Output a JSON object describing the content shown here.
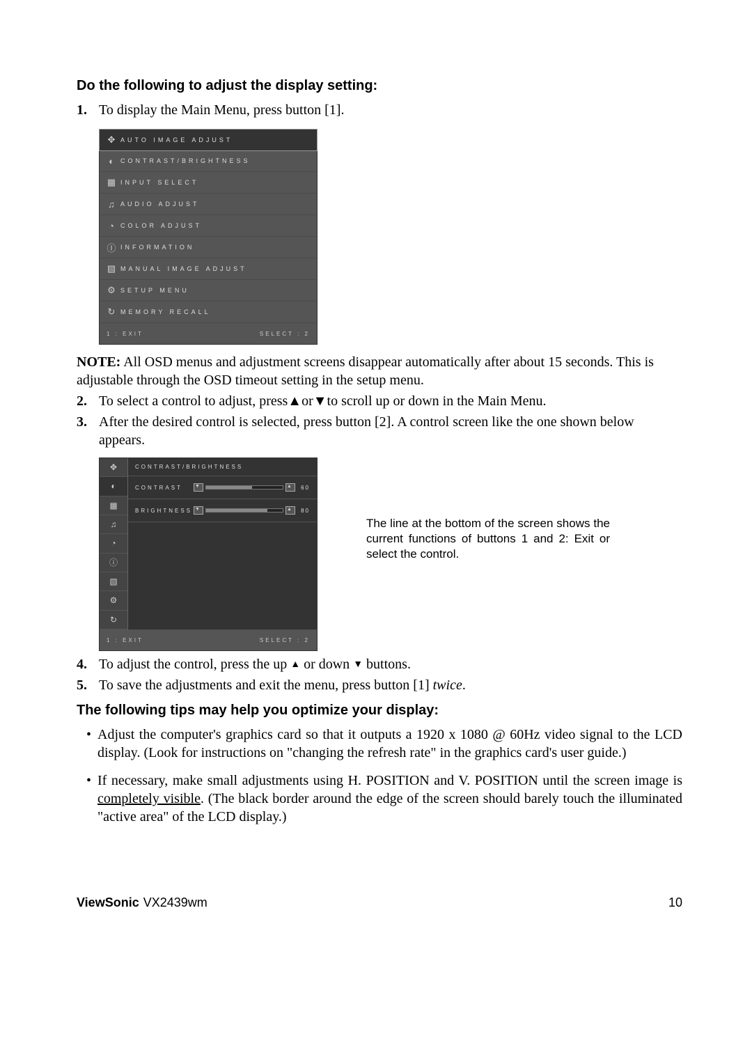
{
  "heading1": "Do the following to adjust the display setting:",
  "steps_a": [
    "To display the Main Menu, press button [1]."
  ],
  "osd1_items": [
    "AUTO IMAGE ADJUST",
    "CONTRAST/BRIGHTNESS",
    "INPUT SELECT",
    "AUDIO ADJUST",
    "COLOR ADJUST",
    "INFORMATION",
    "MANUAL IMAGE ADJUST",
    "SETUP MENU",
    "MEMORY RECALL"
  ],
  "osd_footer_left": "1 : EXIT",
  "osd_footer_right": "SELECT : 2",
  "note_prefix": "NOTE:",
  "note_text": " All OSD menus and adjustment screens disappear automatically after about 15 seconds. This is adjustable through the OSD timeout setting in the setup menu.",
  "steps_b": [
    {
      "n": "2.",
      "t": "To select a control to adjust, press▲or▼to scroll up or down in the Main Menu."
    },
    {
      "n": "3.",
      "t": "After the desired control is selected, press button [2]. A control screen like the one shown below appears."
    }
  ],
  "osd2": {
    "title": "CONTRAST/BRIGHTNESS",
    "rows": [
      {
        "label": "CONTRAST",
        "value": "60"
      },
      {
        "label": "BRIGHTNESS",
        "value": "80"
      }
    ]
  },
  "callout": "The line at the bottom of the screen shows the current functions of buttons 1 and 2: Exit or select the control.",
  "steps_c": [
    {
      "n": "4.",
      "t_a": "To adjust the control, press the up ",
      "t_b": " or down ",
      "t_c": " buttons."
    },
    {
      "n": "5.",
      "t_a": "To save the adjustments and exit the menu, press button [1] ",
      "italic": "twice",
      "t_b": "."
    }
  ],
  "heading2": "The following tips may help you optimize your display:",
  "tips": [
    "Adjust the computer's graphics card so that it outputs a 1920 x 1080 @ 60Hz video signal to the LCD display. (Look for instructions on \"changing the refresh rate\" in the graphics card's user guide.)",
    {
      "pre": "If necessary, make small adjustments using H. POSITION and V. POSITION until the screen image is ",
      "u": "completely visible",
      "post": ". (The black border around the edge of the screen should barely touch the illuminated \"active area\" of the LCD display.)"
    }
  ],
  "footer_brand": "ViewSonic",
  "footer_model": "VX2439wm",
  "footer_page": "10",
  "icons": [
    "✥",
    "◐",
    "▦",
    "♫",
    "◔",
    "ⓘ",
    "▧",
    "⚙",
    "↻"
  ]
}
